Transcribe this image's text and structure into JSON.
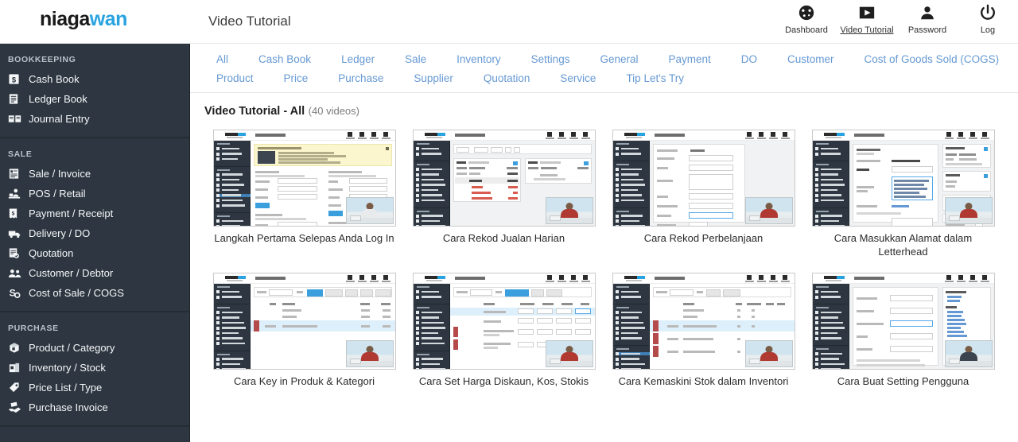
{
  "brand": {
    "name_dark": "niaga",
    "name_accent": "wan",
    "accent_color": "#29a3e0"
  },
  "header": {
    "page_title": "Video Tutorial",
    "nav": [
      {
        "label": "Dashboard",
        "icon": "dashboard-icon",
        "active": false
      },
      {
        "label": "Video Tutorial",
        "icon": "play-icon",
        "active": true
      },
      {
        "label": "Password",
        "icon": "user-icon",
        "active": false
      },
      {
        "label": "Log",
        "icon": "power-icon",
        "active": false
      }
    ]
  },
  "sidebar": {
    "groups": [
      {
        "heading": "BOOKKEEPING",
        "items": [
          {
            "label": "Cash Book",
            "icon": "cash-book-icon"
          },
          {
            "label": "Ledger Book",
            "icon": "ledger-book-icon"
          },
          {
            "label": "Journal Entry",
            "icon": "journal-entry-icon"
          }
        ]
      },
      {
        "heading": "SALE",
        "items": [
          {
            "label": "Sale / Invoice",
            "icon": "invoice-icon"
          },
          {
            "label": "POS / Retail",
            "icon": "pos-icon"
          },
          {
            "label": "Payment / Receipt",
            "icon": "receipt-icon"
          },
          {
            "label": "Delivery / DO",
            "icon": "truck-icon"
          },
          {
            "label": "Quotation",
            "icon": "quotation-icon"
          },
          {
            "label": "Customer / Debtor",
            "icon": "customers-icon"
          },
          {
            "label": "Cost of Sale / COGS",
            "icon": "cogs-icon"
          }
        ]
      },
      {
        "heading": "PURCHASE",
        "items": [
          {
            "label": "Product / Category",
            "icon": "product-icon"
          },
          {
            "label": "Inventory / Stock",
            "icon": "inventory-icon"
          },
          {
            "label": "Price List / Type",
            "icon": "price-tag-icon"
          },
          {
            "label": "Purchase Invoice",
            "icon": "purchase-invoice-icon"
          }
        ]
      }
    ]
  },
  "categories": {
    "row1": [
      "All",
      "Cash Book",
      "Ledger",
      "Sale",
      "Inventory",
      "Settings",
      "General",
      "Payment",
      "DO",
      "Customer",
      "Cost of Goods Sold (COGS)"
    ],
    "row2": [
      "Product",
      "Price",
      "Purchase",
      "Supplier",
      "Quotation",
      "Service",
      "Tip Let's Try"
    ],
    "link_color": "#6699d3"
  },
  "content": {
    "section_title": "Video Tutorial - All",
    "section_count": "(40 videos)",
    "videos": [
      {
        "caption": "Langkah Pertama Selepas Anda Log In",
        "thumb": "form-with-yellow-notice"
      },
      {
        "caption": "Cara Rekod Jualan Harian",
        "thumb": "ledger-entries"
      },
      {
        "caption": "Cara Rekod Perbelanjaan",
        "thumb": "expense-form"
      },
      {
        "caption": "Cara Masukkan Alamat dalam Letterhead",
        "thumb": "letterhead-settings"
      },
      {
        "caption": "Cara Key in Produk & Kategori",
        "thumb": "product-table"
      },
      {
        "caption": "Cara Set Harga Diskaun, Kos, Stokis",
        "thumb": "price-table"
      },
      {
        "caption": "Cara Kemaskini Stok dalam Inventori",
        "thumb": "inventory-table"
      },
      {
        "caption": "Cara Buat Setting Pengguna",
        "thumb": "user-settings"
      }
    ]
  }
}
